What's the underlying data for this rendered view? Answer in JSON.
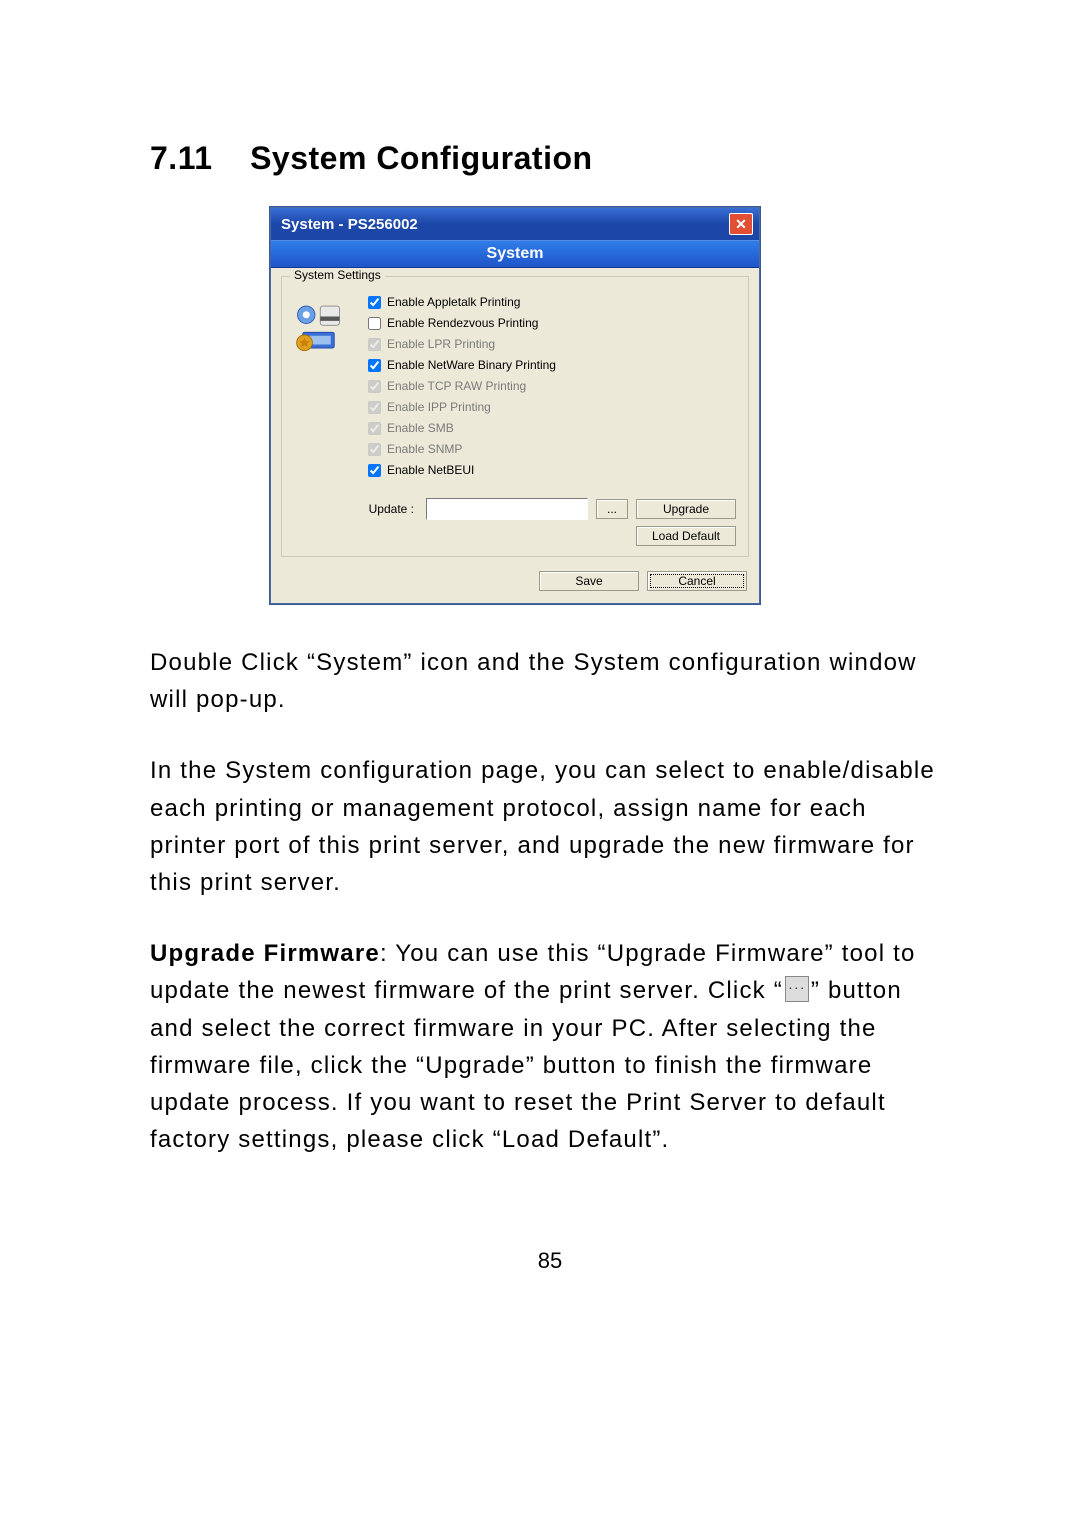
{
  "section": {
    "number": "7.11",
    "title": "System Configuration"
  },
  "dialog": {
    "title": "System - PS256002",
    "band": "System",
    "group_legend": "System Settings",
    "checks": [
      {
        "label": "Enable Appletalk Printing",
        "checked": true,
        "enabled": true
      },
      {
        "label": "Enable Rendezvous Printing",
        "checked": false,
        "enabled": true
      },
      {
        "label": "Enable LPR Printing",
        "checked": true,
        "enabled": false
      },
      {
        "label": "Enable NetWare Binary Printing",
        "checked": true,
        "enabled": true
      },
      {
        "label": "Enable TCP RAW Printing",
        "checked": true,
        "enabled": false
      },
      {
        "label": "Enable IPP Printing",
        "checked": true,
        "enabled": false
      },
      {
        "label": "Enable SMB",
        "checked": true,
        "enabled": false
      },
      {
        "label": "Enable SNMP",
        "checked": true,
        "enabled": false
      },
      {
        "label": "Enable NetBEUI",
        "checked": true,
        "enabled": true
      }
    ],
    "update_label": "Update :",
    "buttons": {
      "browse": "...",
      "upgrade": "Upgrade",
      "load_default": "Load Default",
      "save": "Save",
      "cancel": "Cancel"
    }
  },
  "body": {
    "p1": "Double Click “System” icon and the System configuration window will pop-up.",
    "p2": "In the System configuration page, you can select to enable/disable each printing or management protocol, assign name for each printer port of this print server, and upgrade the new firmware for this print server.",
    "p3_lead": "Upgrade Firmware",
    "p3_rest": ": You can use this “Upgrade Firmware” tool to update the newest firmware of the print server. Click “",
    "p3_tail": "” button and select the correct firmware in your PC. After selecting the firmware file, click the “Upgrade” button to finish the firmware update process. If you want to reset the Print Server to default factory settings, please click “Load Default”."
  },
  "page_number": "85"
}
